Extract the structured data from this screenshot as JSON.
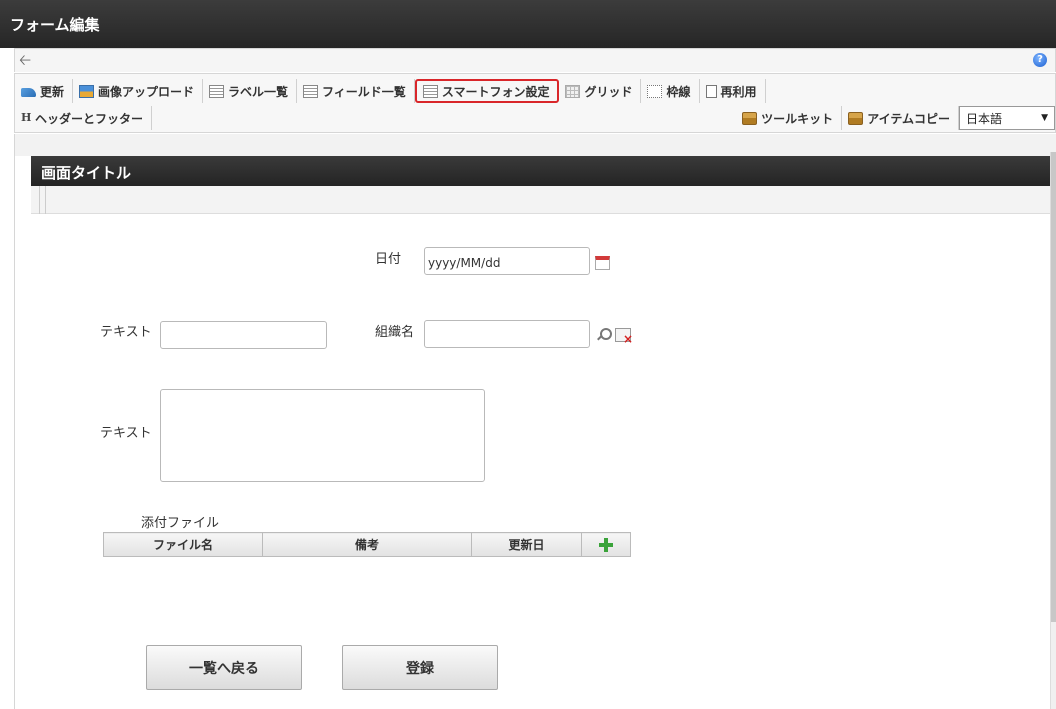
{
  "window": {
    "title": "フォーム編集"
  },
  "toolbar": {
    "row1": [
      {
        "label": "更新",
        "icon": "update-icon"
      },
      {
        "label": "画像アップロード",
        "icon": "image-upload-icon"
      },
      {
        "label": "ラベル一覧",
        "icon": "list-icon"
      },
      {
        "label": "フィールド一覧",
        "icon": "list-icon"
      },
      {
        "label": "スマートフォン設定",
        "icon": "list-icon",
        "highlighted": true
      },
      {
        "label": "グリッド",
        "icon": "grid-icon"
      },
      {
        "label": "枠線",
        "icon": "frame-icon"
      },
      {
        "label": "再利用",
        "icon": "document-icon"
      }
    ],
    "header_footer": "ヘッダーとフッター",
    "toolkit": "ツールキット",
    "item_copy": "アイテムコピー",
    "language": "日本語"
  },
  "panel": {
    "title": "画面タイトル"
  },
  "form": {
    "date_label": "日付",
    "date_placeholder": "yyyy/MM/dd",
    "text_label_1": "テキスト",
    "org_label": "組織名",
    "text_label_2": "テキスト",
    "attachment_label": "添付ファイル",
    "table_headers": [
      "ファイル名",
      "備考",
      "更新日"
    ]
  },
  "buttons": {
    "back": "一覧へ戻る",
    "register": "登録"
  },
  "colors": {
    "highlight": "#d9262a",
    "titlebar": "#2e2e2e",
    "add": "#3aa33a"
  }
}
